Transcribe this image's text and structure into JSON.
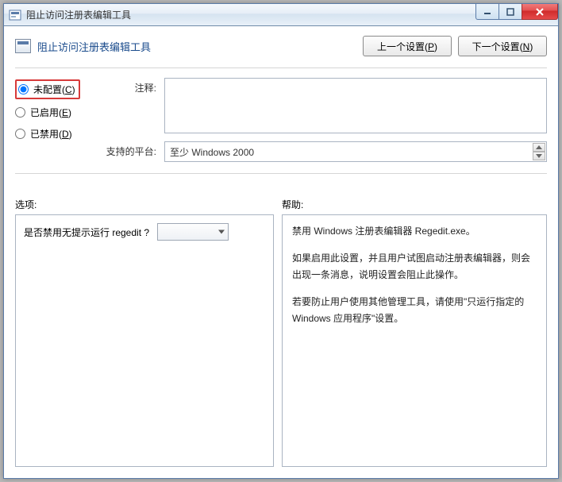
{
  "titlebar": {
    "title": "阻止访问注册表编辑工具"
  },
  "header": {
    "title": "阻止访问注册表编辑工具"
  },
  "nav": {
    "prev": "上一个设置(",
    "prev_key": "P",
    "prev_tail": ")",
    "next": "下一个设置(",
    "next_key": "N",
    "next_tail": ")"
  },
  "radios": {
    "not_configured": "未配置(",
    "not_configured_key": "C",
    "not_configured_tail": ")",
    "enabled": "已启用(",
    "enabled_key": "E",
    "enabled_tail": ")",
    "disabled": "已禁用(",
    "disabled_key": "D",
    "disabled_tail": ")"
  },
  "labels": {
    "comment": "注释:",
    "platforms": "支持的平台:",
    "options": "选项:",
    "help": "帮助:"
  },
  "comment_value": "",
  "platforms_value": "至少 Windows 2000",
  "options": {
    "question": "是否禁用无提示运行 regedit ?"
  },
  "help": {
    "p1": "禁用 Windows 注册表编辑器 Regedit.exe。",
    "p2": "如果启用此设置，并且用户试图启动注册表编辑器，则会出现一条消息，说明设置会阻止此操作。",
    "p3": "若要防止用户使用其他管理工具，请使用\"只运行指定的 Windows 应用程序\"设置。"
  }
}
